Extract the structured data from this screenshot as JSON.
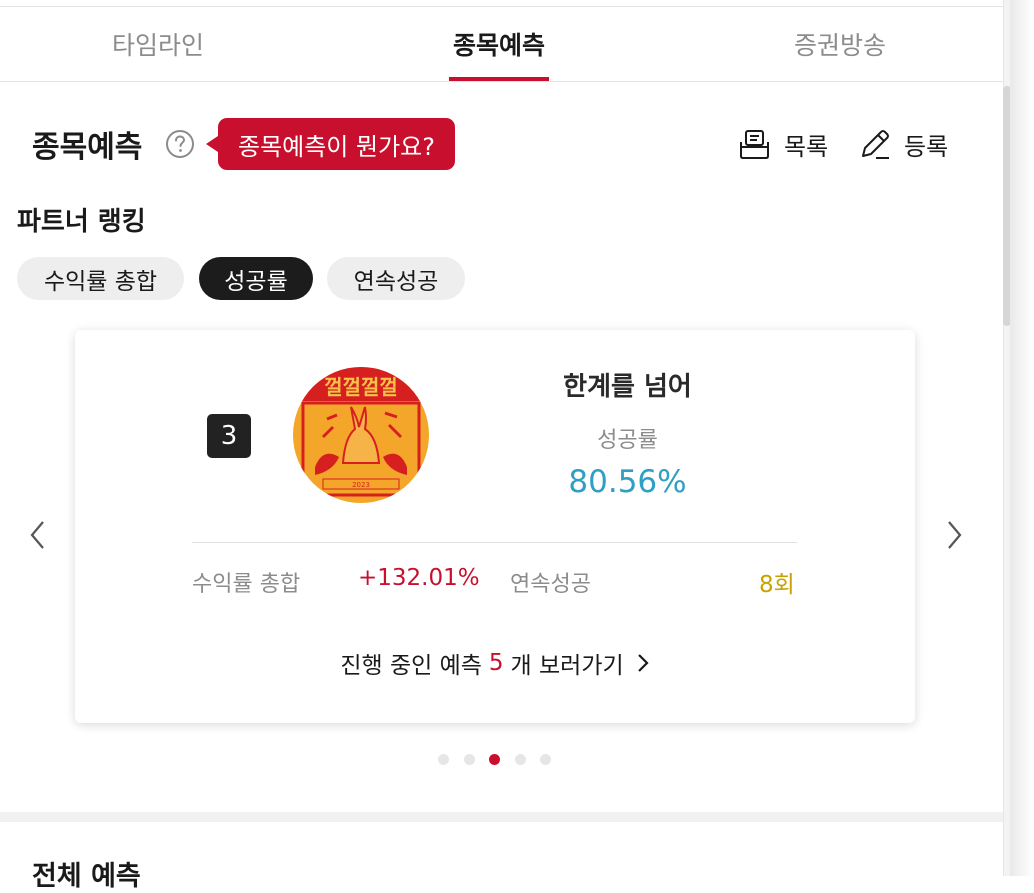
{
  "tabs": [
    {
      "label": "타임라인",
      "active": false
    },
    {
      "label": "종목예측",
      "active": true
    },
    {
      "label": "증권방송",
      "active": false
    }
  ],
  "header": {
    "title": "종목예측",
    "help_icon": "question-circle-icon",
    "tooltip": "종목예측이 뭔가요?",
    "list_label": "목록",
    "register_label": "등록"
  },
  "ranking": {
    "title": "파트너 랭킹",
    "chips": [
      "수익률 총합",
      "성공률",
      "연속성공"
    ],
    "selected_chip": "성공률"
  },
  "card": {
    "rank": "3",
    "nickname": "한계를 넘어",
    "metric_label": "성공률",
    "metric_value": "80.56%",
    "stats": {
      "total_return_label": "수익률 총합",
      "total_return_value": "+132.01%",
      "streak_label": "연속성공",
      "streak_value": "8회"
    },
    "ongoing": {
      "prefix": "진행 중인 예측",
      "count": "5",
      "suffix": "개 보러가기"
    }
  },
  "carousel": {
    "total": 5,
    "active_index": 2
  },
  "all_predictions_title": "전체 예측",
  "colors": {
    "accent": "#c8102e",
    "success_rate": "#2f9fc4",
    "streak": "#c8a300"
  }
}
